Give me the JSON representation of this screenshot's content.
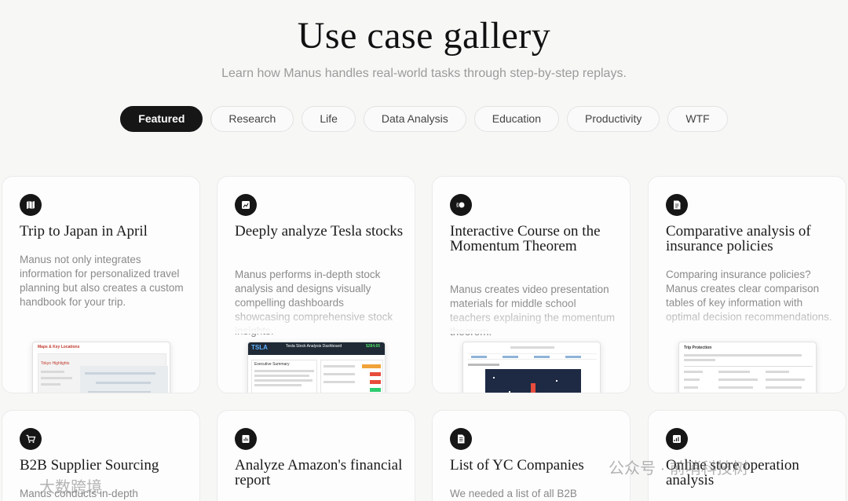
{
  "header": {
    "title": "Use case gallery",
    "subtitle": "Learn how Manus handles real-world tasks through step-by-step replays."
  },
  "tabs": [
    {
      "label": "Featured",
      "active": true
    },
    {
      "label": "Research"
    },
    {
      "label": "Life"
    },
    {
      "label": "Data Analysis"
    },
    {
      "label": "Education"
    },
    {
      "label": "Productivity"
    },
    {
      "label": "WTF"
    }
  ],
  "cards": [
    {
      "icon": "map-book-icon",
      "title": "Trip to Japan in April",
      "description": "Manus not only integrates information for personalized travel planning but also creates a custom handbook for your trip.",
      "preview": {
        "heading": "Maps & Key Locations",
        "subheading": "Tokyo Highlights"
      }
    },
    {
      "icon": "chart-card-icon",
      "title": "Deeply analyze Tesla stocks",
      "description": "Manus performs in-depth stock analysis and designs visually compelling dashboards showcasing comprehensive stock insights.",
      "preview": {
        "ticker": "TSLA",
        "heading": "Tesla Stock Analysis Dashboard",
        "price": "$284.65",
        "section": "Executive Summary"
      }
    },
    {
      "icon": "momentum-icon",
      "title": "Interactive Course on the Momentum Theorem",
      "description": "Manus creates video presentation materials for middle school teachers explaining the momentum theorem.",
      "preview": {}
    },
    {
      "icon": "document-icon",
      "title": "Comparative analysis of insurance policies",
      "description": "Comparing insurance policies? Manus creates clear comparison tables of key information with optimal decision recommendations.",
      "preview": {
        "heading": "Trip Protection"
      }
    },
    {
      "icon": "cart-icon",
      "title": "B2B Supplier Sourcing",
      "description": "Manus conducts in-depth",
      "preview": {}
    },
    {
      "icon": "report-icon",
      "title": "Analyze Amazon's financial report",
      "description": "",
      "preview": {}
    },
    {
      "icon": "list-icon",
      "title": "List of YC Companies",
      "description": "We needed a list of all B2B",
      "preview": {}
    },
    {
      "icon": "analytics-icon",
      "title": "Online store operation analysis",
      "description": "",
      "preview": {}
    }
  ],
  "watermarks": {
    "left": "大数跨境",
    "right": "公众号 · 前哨科技树"
  },
  "colors": {
    "accent": "#161616",
    "background": "#f7f7f6",
    "muted": "#8a8a8a"
  }
}
